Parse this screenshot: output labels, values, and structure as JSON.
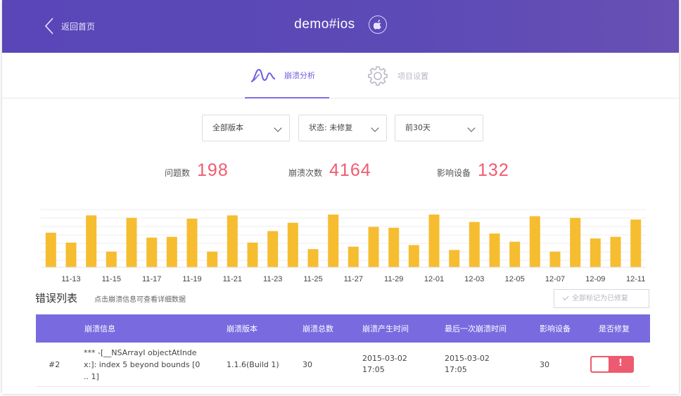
{
  "header": {
    "back_label": "返回首页",
    "app_name": "demo#ios",
    "platform_icon": "apple-icon",
    "colors": {
      "bg": "#5a46b8"
    }
  },
  "tabs": [
    {
      "label": "崩溃分析",
      "icon": "crash-wave-icon",
      "active": true
    },
    {
      "label": "项目设置",
      "icon": "gear-icon",
      "active": false
    }
  ],
  "filters": [
    {
      "value": "全部版本"
    },
    {
      "value": "状态: 未修复"
    },
    {
      "value": "前30天"
    }
  ],
  "stats": [
    {
      "label": "问题数",
      "value": "198"
    },
    {
      "label": "崩溃次数",
      "value": "4164"
    },
    {
      "label": "影响设备",
      "value": "132"
    }
  ],
  "chart_data": {
    "type": "bar",
    "color": "#f6bd30",
    "x_tick_labels": [
      "11-13",
      "11-15",
      "11-17",
      "11-19",
      "11-21",
      "11-23",
      "11-25",
      "11-27",
      "11-29",
      "12-01",
      "12-03",
      "12-05",
      "12-07",
      "12-09",
      "12-11"
    ],
    "values": [
      42,
      30,
      63,
      19,
      60,
      36,
      37,
      59,
      19,
      63,
      30,
      44,
      54,
      22,
      64,
      25,
      49,
      48,
      27,
      64,
      21,
      55,
      41,
      31,
      62,
      19,
      60,
      35,
      37,
      58
    ],
    "grid": true
  },
  "list": {
    "title": "错误列表",
    "hint": "点击崩溃信息可查看详细数据",
    "mark_all_label": "全部标记为已修复",
    "columns": [
      "崩溃信息",
      "崩溃版本",
      "崩溃总数",
      "崩溃产生时间",
      "最后一次崩溃时间",
      "影响设备",
      "是否修复"
    ],
    "rows": [
      {
        "id": "#2",
        "info_lines": [
          "*** -[__NSArrayI objectAtInde",
          "x:]: index 5 beyond bounds [0",
          ".. 1]"
        ],
        "version": "1.1.6(Build 1)",
        "total": "30",
        "first_time_date": "2015-03-02",
        "first_time_clock": "17:05",
        "last_time_date": "2015-03-02",
        "last_time_clock": "17:05",
        "devices": "30",
        "fixed_mark": "!"
      }
    ]
  }
}
